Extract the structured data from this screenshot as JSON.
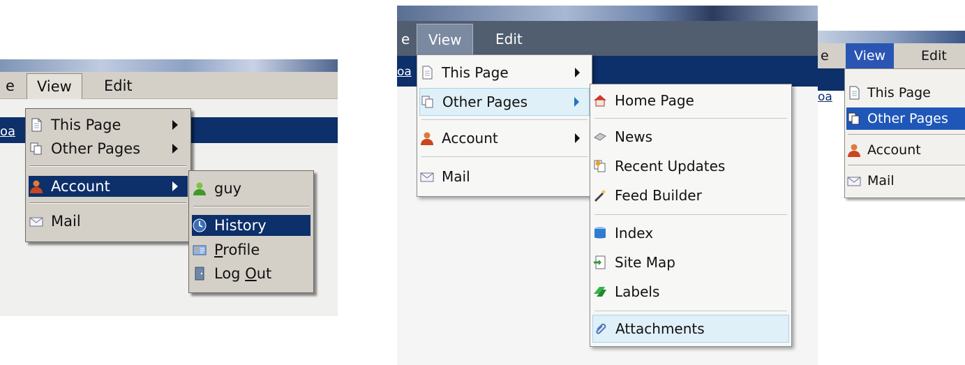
{
  "colors": {
    "classic_menu_bg": "#d4d0c8",
    "navy_selection": "#0d2f6a",
    "modern_menubar": "#505e70",
    "modern_highlight": "#dff0f8",
    "xp_selection": "#1f57b8"
  },
  "panel1": {
    "menubar": {
      "left_fragment": "e",
      "view": "View",
      "edit": "Edit"
    },
    "crumb_fragment": "oa",
    "view_menu": [
      {
        "label": "This Page",
        "icon": "page-icon",
        "submenu": true
      },
      {
        "label": "Other Pages",
        "icon": "pages-icon",
        "submenu": true
      },
      {
        "label": "Account",
        "icon": "user-icon",
        "submenu": true,
        "selected": true
      },
      {
        "label": "Mail",
        "icon": "mail-icon",
        "submenu": false
      }
    ],
    "account_menu": [
      {
        "label": "guy",
        "icon": "green-user-icon"
      },
      {
        "label": "History",
        "icon": "clock-icon",
        "selected": true
      },
      {
        "label": "Profile",
        "icon": "profile-card-icon",
        "mnemonic": "P"
      },
      {
        "label_before": "Log ",
        "mnemonic": "O",
        "label_after": "ut",
        "icon": "door-icon"
      }
    ]
  },
  "panel2": {
    "menubar": {
      "left_fragment": "e",
      "view": "View",
      "edit": "Edit"
    },
    "crumb_fragment": "oa",
    "view_menu": [
      {
        "label": "This Page",
        "icon": "page-icon",
        "submenu": true
      },
      {
        "label": "Other Pages",
        "icon": "pages-icon",
        "submenu": true,
        "highlighted": true
      },
      {
        "label": "Account",
        "icon": "user-icon",
        "submenu": true
      },
      {
        "label": "Mail",
        "icon": "mail-icon",
        "submenu": false
      }
    ],
    "other_pages_menu": [
      {
        "label": "Home Page",
        "icon": "house-icon"
      },
      {
        "label": "News",
        "icon": "newspaper-icon"
      },
      {
        "label": "Recent Updates",
        "icon": "recent-pages-icon"
      },
      {
        "label": "Feed Builder",
        "icon": "magic-wand-icon"
      },
      {
        "label": "Index",
        "icon": "database-icon"
      },
      {
        "label": "Site Map",
        "icon": "sitemap-icon"
      },
      {
        "label": "Labels",
        "icon": "labels-icon"
      },
      {
        "label": "Attachments",
        "icon": "paperclip-icon",
        "highlighted": true
      }
    ]
  },
  "panel3": {
    "menubar": {
      "left_fragment": "e",
      "view": "View",
      "edit": "Edit"
    },
    "crumb_fragment": "oa",
    "view_menu": [
      {
        "label": "This Page",
        "icon": "page-icon"
      },
      {
        "label": "Other Pages",
        "icon": "pages-icon",
        "selected": true
      },
      {
        "label": "Account",
        "icon": "user-icon"
      },
      {
        "label": "Mail",
        "icon": "mail-icon"
      }
    ]
  }
}
